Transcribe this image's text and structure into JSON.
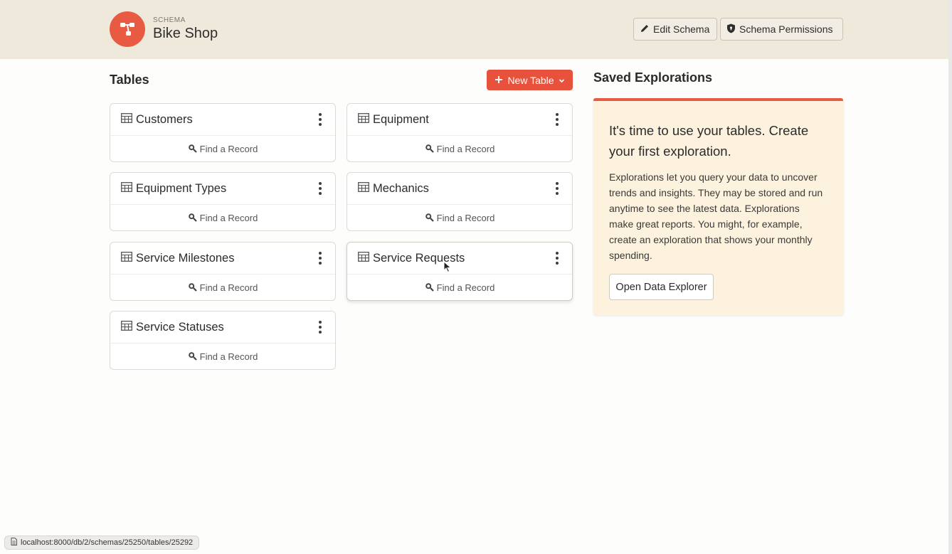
{
  "header": {
    "schema_label": "SCHEMA",
    "schema_name": "Bike Shop",
    "edit_schema_label": "Edit Schema",
    "schema_permissions_label": "Schema Permissions"
  },
  "tables_section": {
    "title": "Tables",
    "new_table_label": "New Table",
    "find_record_label": "Find a Record",
    "tables": [
      {
        "name": "Customers"
      },
      {
        "name": "Equipment"
      },
      {
        "name": "Equipment Types"
      },
      {
        "name": "Mechanics"
      },
      {
        "name": "Service Milestones"
      },
      {
        "name": "Service Requests"
      },
      {
        "name": "Service Statuses"
      }
    ]
  },
  "saved_explorations": {
    "title": "Saved Explorations",
    "heading": "It's time to use your tables. Create your first exploration.",
    "body": "Explorations let you query your data to uncover trends and insights. They may be stored and run anytime to see the latest data. Explorations make great reports. You might, for example, create an exploration that shows your monthly spending.",
    "open_button_label": "Open Data Explorer"
  },
  "status_bar": {
    "url": "localhost:8000/db/2/schemas/25250/tables/25292"
  },
  "colors": {
    "accent": "#e95a43",
    "header_bg": "#efe9dc",
    "panel_bg": "#fdf2dd"
  }
}
